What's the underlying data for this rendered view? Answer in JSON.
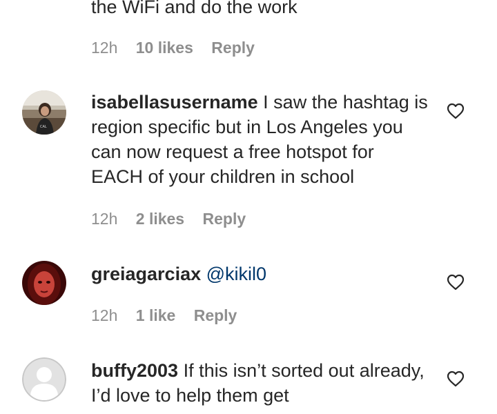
{
  "comments": [
    {
      "text_tail": "the WiFi and do the work",
      "time": "12h",
      "likes": "10 likes",
      "reply": "Reply"
    },
    {
      "username": "isabellasusername",
      "text": "I saw the hashtag is region specific but in Los Angeles you can now request a free hotspot for EACH of your children in school",
      "time": "12h",
      "likes": "2 likes",
      "reply": "Reply"
    },
    {
      "username": "greiagarciax",
      "mention": "@kikil0",
      "time": "12h",
      "likes": "1 like",
      "reply": "Reply"
    },
    {
      "username": "buffy2003",
      "text": "If this isn’t sorted out already, I’d love to help them get"
    }
  ],
  "icons": {
    "like": "heart-outline-icon",
    "default_avatar": "person-silhouette-icon"
  },
  "colors": {
    "text": "#262626",
    "meta": "#8e8e8e",
    "mention": "#00376b"
  }
}
